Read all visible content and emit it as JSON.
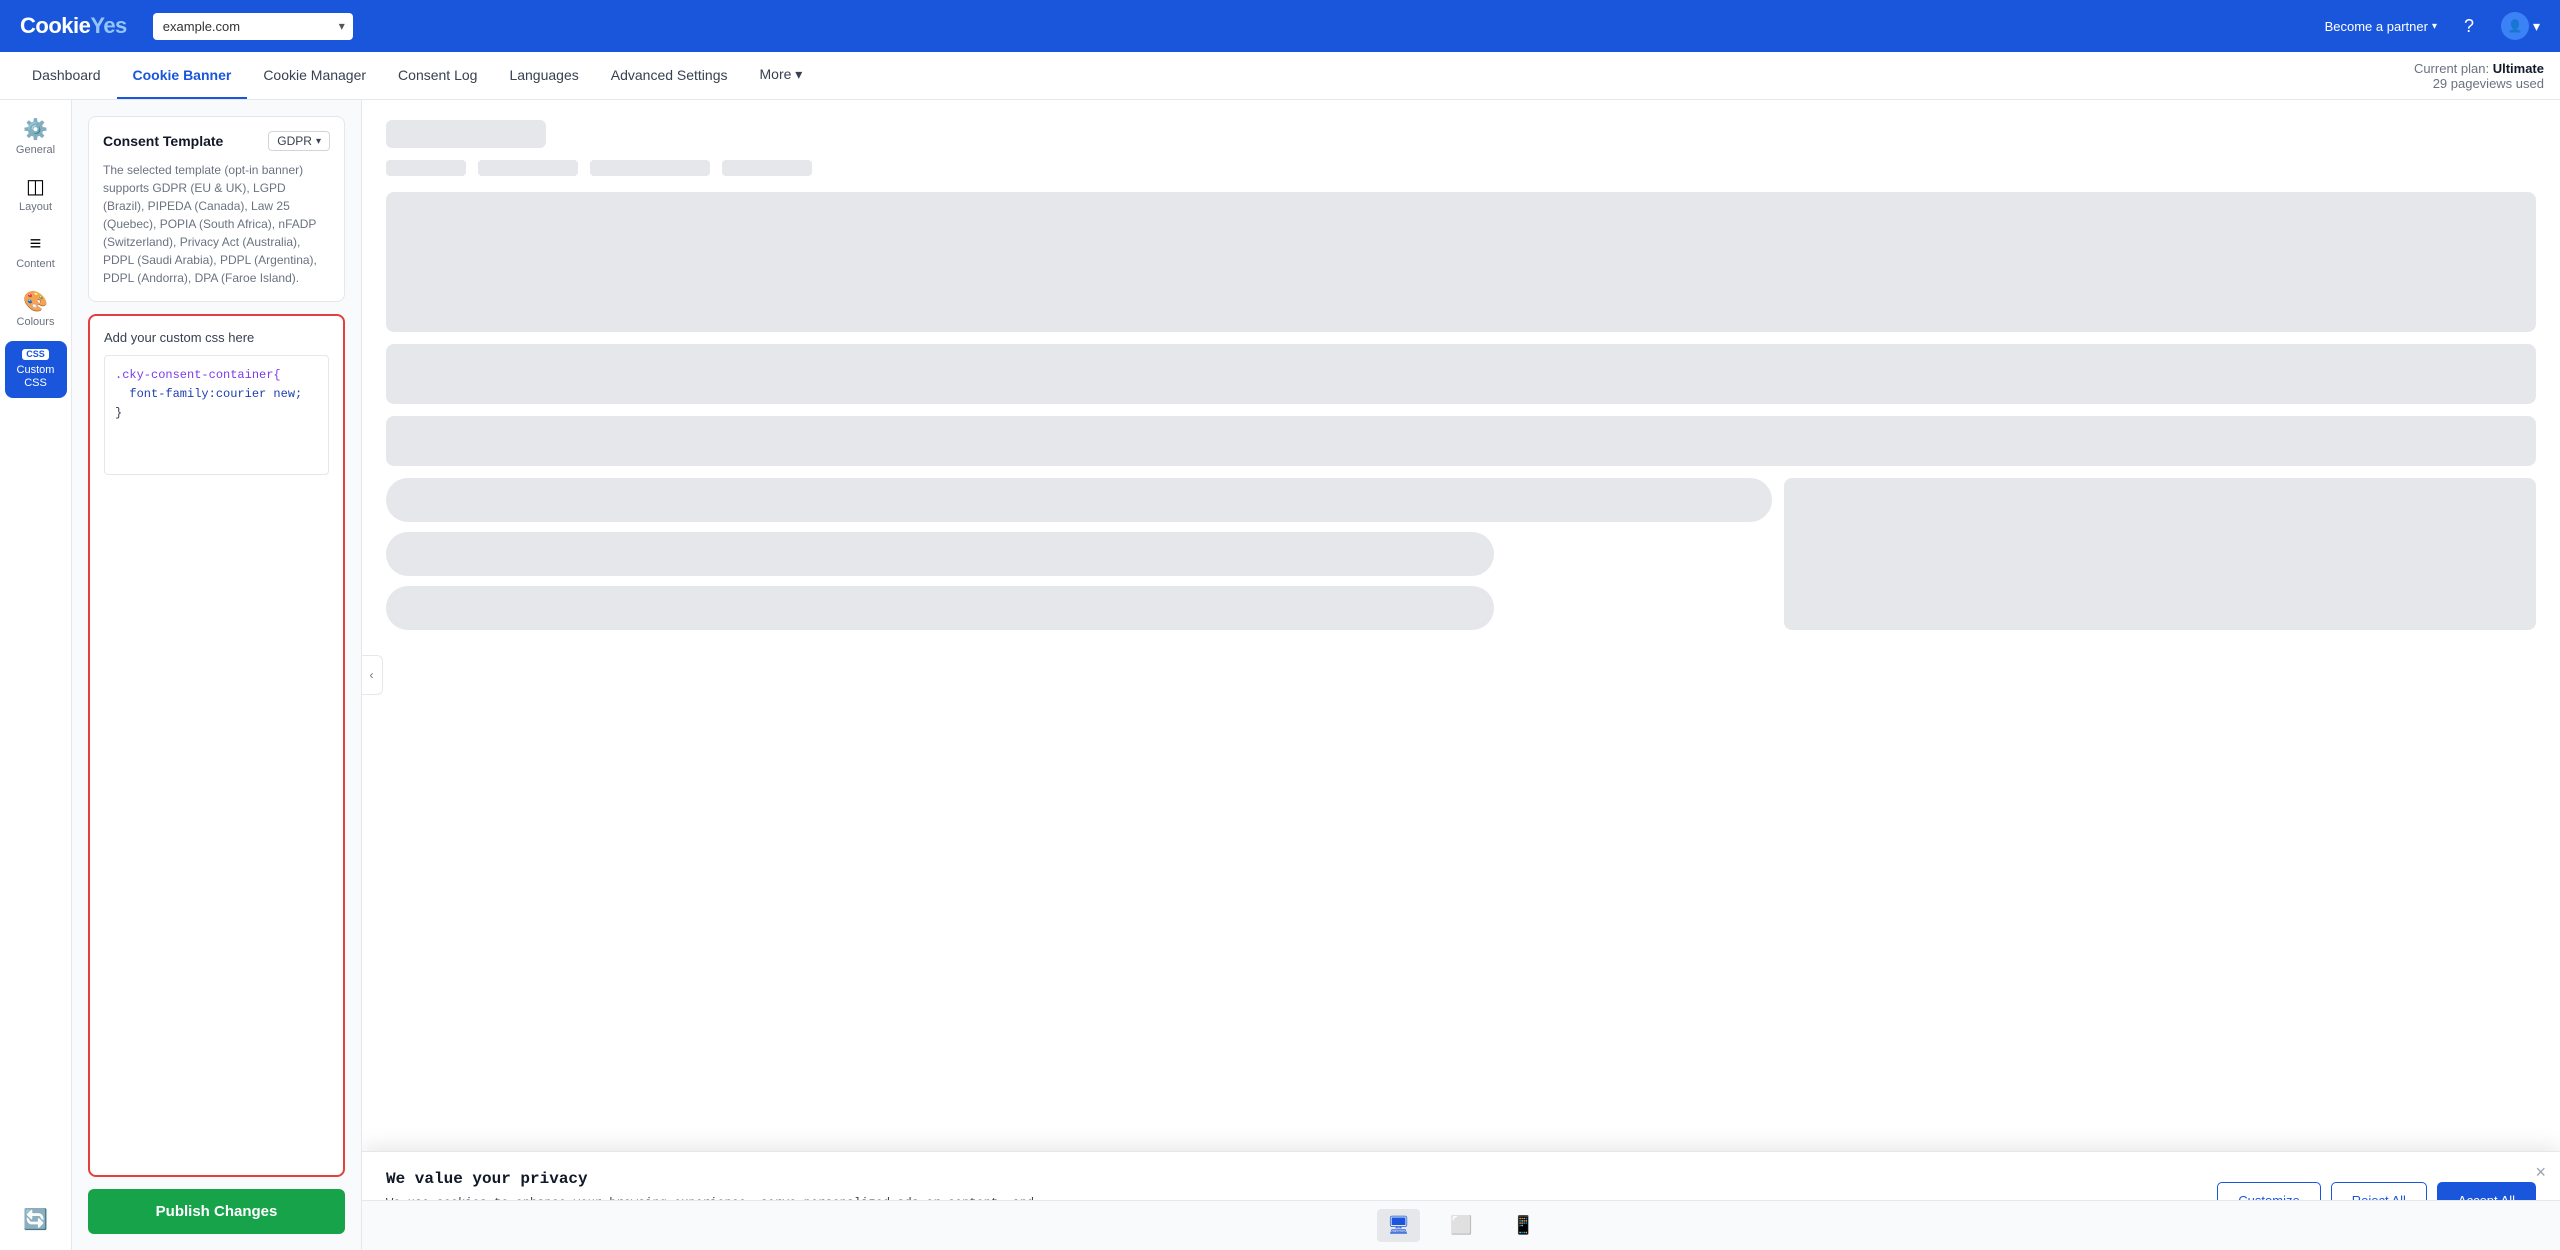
{
  "app": {
    "name": "CookieYes",
    "logo_text": "Cookieyes",
    "logo_eye": "👁"
  },
  "topbar": {
    "domain_placeholder": "example.com",
    "become_partner": "Become a partner",
    "help_icon": "?",
    "current_plan_label": "Current plan:",
    "current_plan_value": "Ultimate",
    "pageviews_label": "29 pageviews used"
  },
  "nav": {
    "tabs": [
      {
        "id": "dashboard",
        "label": "Dashboard",
        "active": false
      },
      {
        "id": "cookie-banner",
        "label": "Cookie Banner",
        "active": true
      },
      {
        "id": "cookie-manager",
        "label": "Cookie Manager",
        "active": false
      },
      {
        "id": "consent-log",
        "label": "Consent Log",
        "active": false
      },
      {
        "id": "languages",
        "label": "Languages",
        "active": false
      },
      {
        "id": "advanced-settings",
        "label": "Advanced Settings",
        "active": false
      },
      {
        "id": "more",
        "label": "More ▾",
        "active": false
      }
    ]
  },
  "icon_sidebar": {
    "items": [
      {
        "id": "general",
        "label": "General",
        "icon": "⚙",
        "active": false
      },
      {
        "id": "layout",
        "label": "Layout",
        "icon": "▦",
        "active": false
      },
      {
        "id": "content",
        "label": "Content",
        "icon": "☰",
        "active": false
      },
      {
        "id": "colours",
        "label": "Colours",
        "icon": "🎨",
        "active": false
      },
      {
        "id": "custom-css",
        "label": "Custom CSS",
        "badge": "CSS",
        "active": true
      }
    ]
  },
  "left_panel": {
    "consent_template": {
      "title": "Consent Template",
      "regulation": "GDPR",
      "description": "The selected template (opt-in banner) supports GDPR (EU & UK), LGPD (Brazil), PIPEDA (Canada), Law 25 (Quebec), POPIA (South Africa), nFADP (Switzerland), Privacy Act (Australia), PDPL (Saudi Arabia), PDPL (Argentina), PDPL (Andorra), DPA (Faroe Island)."
    },
    "custom_css": {
      "title": "Add your custom css here",
      "code_lines": [
        ".cky-consent-container{",
        "  font-family:courier new;",
        "}"
      ]
    },
    "publish_button": "Publish Changes"
  },
  "cookie_banner": {
    "title": "We value your privacy",
    "body": "We use cookies to enhance your browsing experience, serve personalized ads or content, and\nanalyze our traffic. By clicking \"Accept All\", you consent to our use of cookies.",
    "buttons": {
      "customize": "Customize",
      "reject": "Reject All",
      "accept": "Accept All"
    }
  },
  "devices": [
    {
      "id": "desktop",
      "icon": "🖥",
      "active": true
    },
    {
      "id": "tablet",
      "icon": "⬜",
      "active": false
    },
    {
      "id": "mobile",
      "icon": "📱",
      "active": false
    }
  ]
}
